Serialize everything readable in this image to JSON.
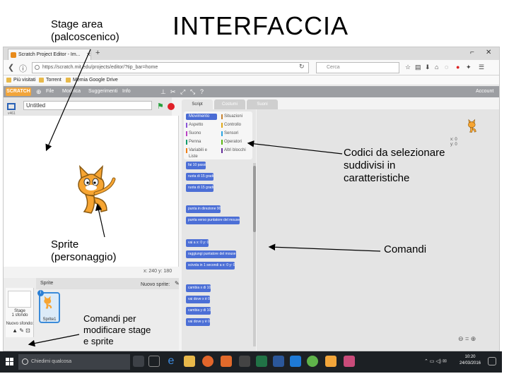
{
  "annotations": {
    "stage_area": "Stage area\n(palcoscenico)",
    "title": "INTERFACCIA",
    "codici": "Codici da selezionare\nsuddivisi in\ncaratteristiche",
    "sprite": "Sprite\n(personaggio)",
    "comandi": "Comandi",
    "comandi_per": "Comandi per\nmodificare stage\ne sprite"
  },
  "browser": {
    "tab_title": "Scratch Project Editor - Im...",
    "url": "https://scratch.mit.edu/projects/editor/?tip_bar=home",
    "search_placeholder": "Cerca",
    "bookmarks": [
      "Più visitati",
      "Torrent",
      "Memia Google Drive"
    ],
    "colors": {
      "scratch_menu": "#9c9ea2",
      "logo": "#f2a53a"
    }
  },
  "scratch": {
    "logo": "SCRATCH",
    "menu": [
      "File",
      "Modifica",
      "Suggerimenti",
      "Info"
    ],
    "account": "Account",
    "project_name": "Untitled",
    "version": "v461",
    "tabs": [
      "Script",
      "Costumi",
      "Suoni"
    ],
    "categories_left": [
      "Movimento",
      "Aspetto",
      "Suono",
      "Penna",
      "Variabili e Liste"
    ],
    "categories_right": [
      "Situazioni",
      "Controllo",
      "Sensori",
      "Operatori",
      "Altri blocchi"
    ],
    "category_colors": [
      "#4a6cd4",
      "#8a55d7",
      "#bb42c3",
      "#0e9a6c",
      "#ee7d16",
      "#c88330",
      "#e1a91a",
      "#2ca5e2",
      "#5cb712",
      "#632d99"
    ],
    "blocks": [
      "fai 10 passi",
      "ruota di 15 gradi",
      "ruota di 15 gradi",
      "punta in direzione 90",
      "punta verso puntatore del mouse",
      "vai a x: 0 y: 0",
      "raggiungi puntatore del mouse",
      "scivola in 1 secondi a x: 0 y: 0",
      "cambia x di 10",
      "vai dove x è 0",
      "cambia y di 10",
      "vai dove y è 0"
    ],
    "sprite_toolbar": "x: 240  y: 180",
    "sprite_header": "Sprite",
    "new_sprite": "Nuovo sprite:",
    "stage_label": "Stage\n1 sfondo",
    "new_backdrop": "Nuovo sfondo:",
    "sprite_name": "Sprite1",
    "coords": "x: 0\ny: 0"
  },
  "taskbar": {
    "search": "Chiedimi qualcosa",
    "time": "10:20",
    "date": "24/03/2016"
  }
}
